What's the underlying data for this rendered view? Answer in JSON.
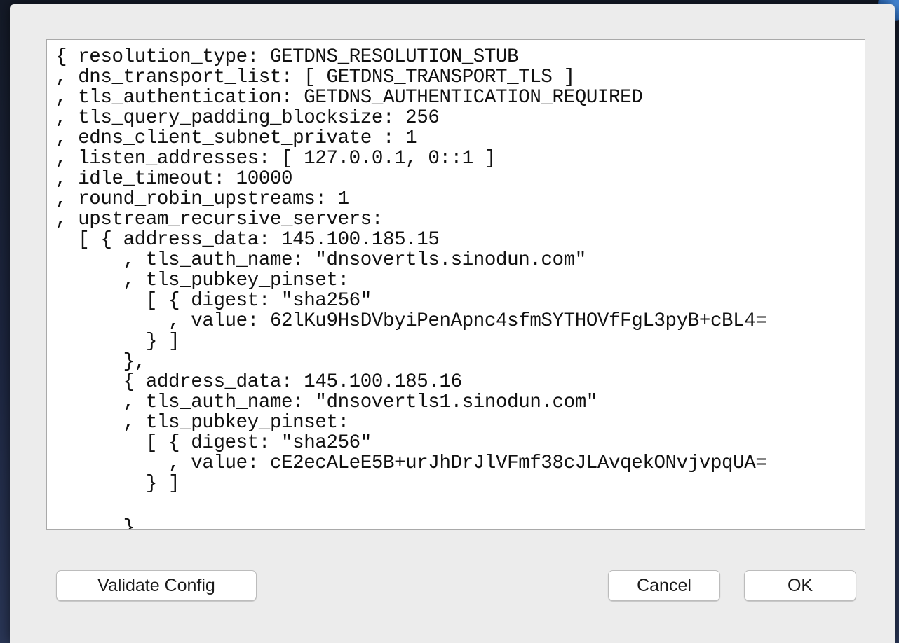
{
  "editor": {
    "lines": [
      "{ resolution_type: GETDNS_RESOLUTION_STUB",
      ", dns_transport_list: [ GETDNS_TRANSPORT_TLS ]",
      ", tls_authentication: GETDNS_AUTHENTICATION_REQUIRED",
      ", tls_query_padding_blocksize: 256",
      ", edns_client_subnet_private : 1",
      ", listen_addresses: [ 127.0.0.1, 0::1 ]",
      ", idle_timeout: 10000",
      ", round_robin_upstreams: 1",
      ", upstream_recursive_servers:",
      "  [ { address_data: 145.100.185.15",
      "      , tls_auth_name: \"dnsovertls.sinodun.com\"",
      "      , tls_pubkey_pinset:",
      "        [ { digest: \"sha256\"",
      "          , value: 62lKu9HsDVbyiPenApnc4sfmSYTHOVfFgL3pyB+cBL4=",
      "        } ]",
      "      },",
      "      { address_data: 145.100.185.16",
      "      , tls_auth_name: \"dnsovertls1.sinodun.com\"",
      "      , tls_pubkey_pinset:",
      "        [ { digest: \"sha256\"",
      "          , value: cE2ecALeE5B+urJhDrJlVFmf38cJLAvqekONvjvpqUA=",
      "        } ]",
      "      },"
    ]
  },
  "buttons": {
    "validate_label": "Validate Config",
    "cancel_label": "Cancel",
    "ok_label": "OK"
  }
}
